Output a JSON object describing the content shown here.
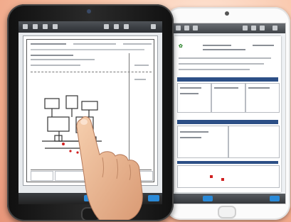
{
  "scene": {
    "description_name": "two-tablets-document-viewer",
    "colors": {
      "background_peach": "#f0a98a",
      "toolbar_dark": "#3f4348",
      "accent_blue": "#2a8ad8",
      "band_blue": "#2c4f86",
      "logo_green": "#3a8d3a",
      "markup_red": "#d02020"
    }
  },
  "white_tablet": {
    "toolbar_icons": [
      "back-icon",
      "grid-icon",
      "bookmark-icon",
      "search-icon",
      "share-icon",
      "pen-icon",
      "settings-icon"
    ],
    "logo_text": "",
    "bottom_buttons": [
      "page-button",
      "done-button"
    ]
  },
  "black_tablet": {
    "toolbar_icons": [
      "back-icon",
      "grid-icon",
      "bookmark-icon",
      "search-icon",
      "share-icon",
      "pen-icon",
      "settings-icon"
    ],
    "bottom_buttons": [
      "page-button",
      "done-button"
    ]
  }
}
